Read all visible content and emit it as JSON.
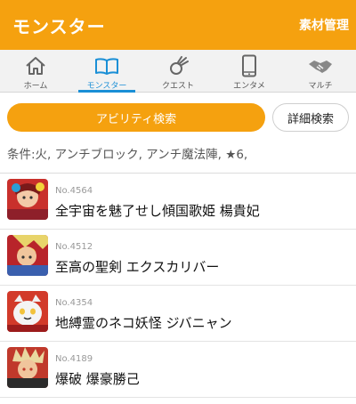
{
  "header": {
    "title": "モンスター",
    "materials_link": "素材管理"
  },
  "tabs": [
    {
      "label": "ホーム",
      "icon": "home-icon",
      "active": false
    },
    {
      "label": "モンスター",
      "icon": "book-icon",
      "active": true
    },
    {
      "label": "クエスト",
      "icon": "quest-icon",
      "active": false
    },
    {
      "label": "エンタメ",
      "icon": "smartphone-icon",
      "active": false
    },
    {
      "label": "マルチ",
      "icon": "handshake-icon",
      "active": false
    }
  ],
  "actions": {
    "ability_search": "アビリティ検索",
    "detail_search": "詳細検索"
  },
  "condition": "条件:火, アンチブロック, アンチ魔法陣, ★6,",
  "monsters": [
    {
      "number": "No.4564",
      "name": "全宇宙を魅了せし傾国歌姫 楊貴妃"
    },
    {
      "number": "No.4512",
      "name": "至高の聖剣 エクスカリバー"
    },
    {
      "number": "No.4354",
      "name": "地縛霊のネコ妖怪 ジバニャン"
    },
    {
      "number": "No.4189",
      "name": "爆破 爆豪勝己"
    }
  ],
  "colors": {
    "accent": "#f5a10f",
    "active_tab": "#1a8fd6"
  }
}
